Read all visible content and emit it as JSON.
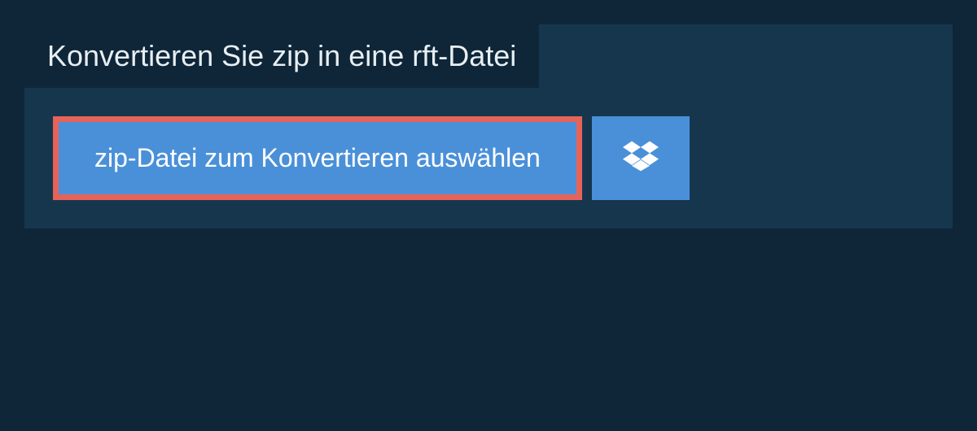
{
  "header": {
    "title": "Konvertieren Sie zip in eine rft-Datei"
  },
  "actions": {
    "select_file_label": "zip-Datei zum Konvertieren auswählen"
  },
  "colors": {
    "background": "#0e2638",
    "panel": "#16364e",
    "button": "#4a90d9",
    "highlight_border": "#e6635a"
  }
}
